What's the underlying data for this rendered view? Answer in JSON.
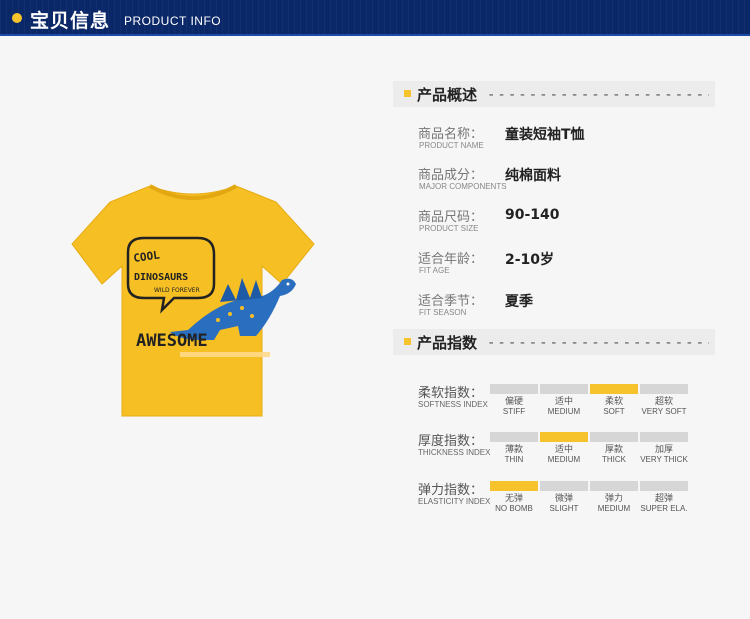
{
  "header": {
    "title_cn": "宝贝信息",
    "title_en": "PRODUCT INFO"
  },
  "colors": {
    "header_bg": "#0a2767",
    "accent": "#f7c32c",
    "shirt": "#f6bf24",
    "dino": "#2a6fbf"
  },
  "product_image": {
    "alt": "Yellow children's t-shirt with dinosaur print",
    "print_text": {
      "bubble_line1": "COOL",
      "bubble_line2": "DINOSAURS",
      "bubble_line3": "WILD FOREVER",
      "main": "AWESOME"
    }
  },
  "overview": {
    "heading": "产品概述",
    "dashes": "------------------------",
    "rows": [
      {
        "label_cn": "商品名称：",
        "label_en": "PRODUCT NAME",
        "value": "童装短袖T恤"
      },
      {
        "label_cn": "商品成分：",
        "label_en": "MAJOR COMPONENTS",
        "value": "纯棉面料"
      },
      {
        "label_cn": "商品尺码：",
        "label_en": "PRODUCT SIZE",
        "value": "90-140"
      },
      {
        "label_cn": "适合年龄：",
        "label_en": "FIT AGE",
        "value": "2-10岁"
      },
      {
        "label_cn": "适合季节：",
        "label_en": "FIT SEASON",
        "value": "夏季"
      }
    ]
  },
  "indices": {
    "heading": "产品指数",
    "dashes": "------------------------",
    "rows": [
      {
        "label_cn": "柔软指数：",
        "label_en": "SOFTNESS INDEX",
        "selected": 2,
        "options": [
          {
            "cn": "偏硬",
            "en": "STIFF"
          },
          {
            "cn": "适中",
            "en": "MEDIUM"
          },
          {
            "cn": "柔软",
            "en": "SOFT"
          },
          {
            "cn": "超软",
            "en": "VERY SOFT"
          }
        ]
      },
      {
        "label_cn": "厚度指数：",
        "label_en": "THICKNESS INDEX",
        "selected": 1,
        "options": [
          {
            "cn": "薄款",
            "en": "THIN"
          },
          {
            "cn": "适中",
            "en": "MEDIUM"
          },
          {
            "cn": "厚款",
            "en": "THICK"
          },
          {
            "cn": "加厚",
            "en": "VERY THICK"
          }
        ]
      },
      {
        "label_cn": "弹力指数：",
        "label_en": "ELASTICITY INDEX",
        "selected": 0,
        "options": [
          {
            "cn": "无弹",
            "en": "NO BOMB"
          },
          {
            "cn": "微弹",
            "en": "SLIGHT"
          },
          {
            "cn": "弹力",
            "en": "MEDIUM"
          },
          {
            "cn": "超弹",
            "en": "SUPER ELA."
          }
        ]
      }
    ]
  }
}
